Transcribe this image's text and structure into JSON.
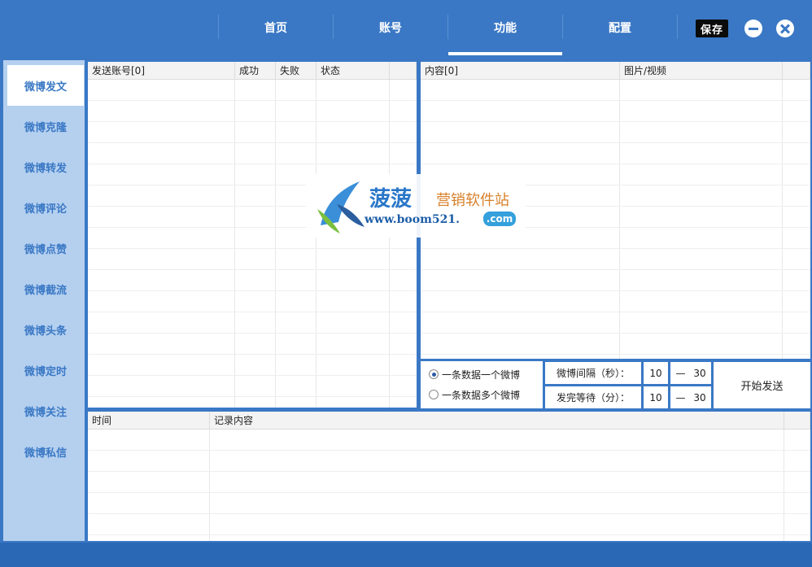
{
  "nav": {
    "tabs": [
      {
        "label": "首页"
      },
      {
        "label": "账号"
      },
      {
        "label": "功能"
      },
      {
        "label": "配置"
      }
    ],
    "save_label": "保存",
    "minimize_icon": "minimize-icon",
    "close_icon": "close-icon"
  },
  "sidebar": {
    "items": [
      {
        "label": "微博发文"
      },
      {
        "label": "微博克隆"
      },
      {
        "label": "微博转发"
      },
      {
        "label": "微博评论"
      },
      {
        "label": "微博点赞"
      },
      {
        "label": "微博截流"
      },
      {
        "label": "微博头条"
      },
      {
        "label": "微博定时"
      },
      {
        "label": "微博关注"
      },
      {
        "label": "微博私信"
      }
    ]
  },
  "accounts_table": {
    "columns": [
      "发送账号[0]",
      "成功",
      "失败",
      "状态"
    ]
  },
  "content_table": {
    "columns": [
      "内容[0]",
      "图片/视频"
    ]
  },
  "settings": {
    "radio_one": "一条数据一个微博",
    "radio_multi": "一条数据多个微博",
    "interval_label": "微博间隔（秒）：",
    "interval_min": "10",
    "interval_dash": "—",
    "interval_max": "30",
    "wait_label": "发完等待（分）：",
    "wait_min": "10",
    "wait_dash": "—",
    "wait_max": "30",
    "start_label": "开始发送"
  },
  "log_table": {
    "columns": [
      "时间",
      "记录内容"
    ]
  },
  "watermark": {
    "name": "菠菠",
    "subtitle": "营销软件站",
    "url": "www.boom521.",
    "tld": ".com"
  },
  "colors": {
    "primary": "#3a78c5",
    "sidebar": "#b5d0ef",
    "footer": "#2a67b5"
  }
}
